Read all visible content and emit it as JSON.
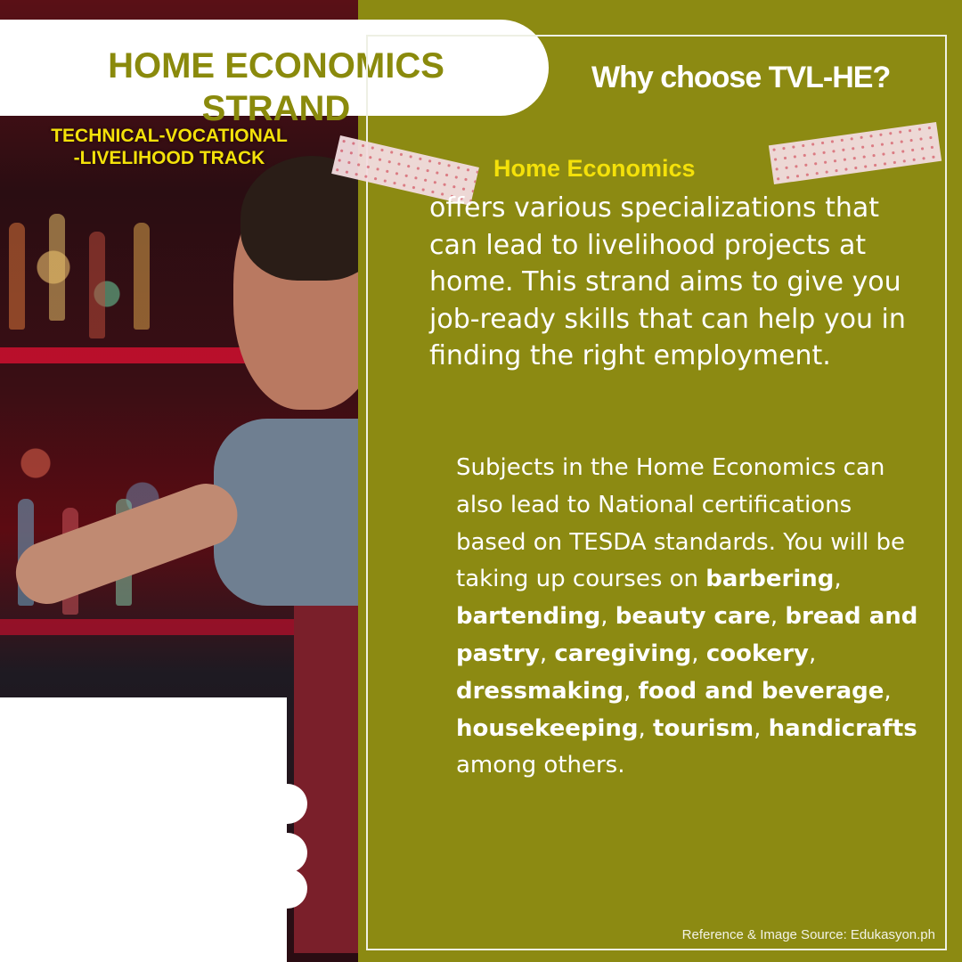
{
  "title": {
    "line1": "HOME ECONOMICS",
    "line2": "STRAND"
  },
  "track": {
    "line1": "TECHNICAL-VOCATIONAL",
    "line2": "-LIVELIHOOD TRACK"
  },
  "heading": "Why choose TVL-HE?",
  "highlight_label": "Home Economics",
  "paragraph1": "offers various specializations that can lead to livelihood projects at home. This strand aims to give you job-ready skills that can help you in finding the right employment.",
  "paragraph2": {
    "intro": "Subjects in the Home Economics can also lead to National certifications based on TESDA standards. You will be taking up courses on ",
    "courses": [
      "barbering",
      "bartending",
      "beauty care",
      "bread and pastry",
      "caregiving",
      "cookery",
      "dressmaking",
      "food and beverage",
      "housekeeping",
      "tourism",
      "handicrafts"
    ],
    "sep": ", ",
    "outro": " among others."
  },
  "source": "Reference & Image Source: Edukasyon.ph",
  "colors": {
    "background": "#8c8a12",
    "title": "#8a8a0c",
    "accent": "#f4e10a",
    "text": "#ffffff"
  }
}
